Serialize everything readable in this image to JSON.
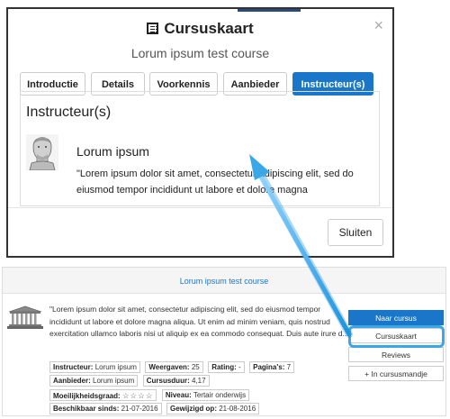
{
  "modal": {
    "title": "Cursuskaart",
    "subtitle": "Lorum ipsum test course",
    "close_glyph": "×",
    "tabs": [
      {
        "label": "Introductie",
        "active": false
      },
      {
        "label": "Details",
        "active": false
      },
      {
        "label": "Voorkennis",
        "active": false
      },
      {
        "label": "Aanbieder",
        "active": false
      },
      {
        "label": "Instructeur(s)",
        "active": true
      }
    ],
    "panel": {
      "heading": "Instructeur(s)",
      "instructor_name": "Lorum ipsum",
      "instructor_text": "\"Lorem ipsum dolor sit amet, consectetur adipiscing elit, sed do eiusmod tempor incididunt ut labore et dolore magna"
    },
    "close_button": "Sluiten"
  },
  "card": {
    "title": "Lorum ipsum test course",
    "description": "\"Lorem ipsum dolor sit amet, consectetur adipiscing elit, sed do eiusmod tempor incididunt ut labore et dolore magna aliqua. Ut enim ad minim veniam, quis nostrud exercitation ullamco laboris nisi ut aliquip ex ea commodo consequat. Duis aute irure d...",
    "meta": {
      "instructeur": {
        "label": "Instructeur:",
        "value": "Lorum ipsum"
      },
      "weergaven": {
        "label": "Weergaven:",
        "value": "25"
      },
      "rating": {
        "label": "Rating:",
        "value": "-"
      },
      "paginas": {
        "label": "Pagina's:",
        "value": "7"
      },
      "aanbieder": {
        "label": "Aanbieder:",
        "value": "Lorum ipsum"
      },
      "cursusduur": {
        "label": "Cursusduur:",
        "value": "4,17"
      },
      "moeilijkheid": {
        "label": "Moeilijkheidsgraad:",
        "stars": "☆☆☆☆"
      },
      "niveau": {
        "label": "Niveau:",
        "value": "Tertair onderwijs"
      },
      "beschikbaar": {
        "label": "Beschikbaar sinds:",
        "value": "21-07-2016"
      },
      "gewijzigd": {
        "label": "Gewijzigd op:",
        "value": "21-08-2016"
      }
    },
    "actions": {
      "naar_cursus": "Naar cursus",
      "cursuskaart": "Cursuskaart",
      "reviews": "Reviews",
      "mandje_plus": "+",
      "mandje": "In cursusmandje"
    }
  },
  "colors": {
    "accent": "#1a76c9",
    "highlight": "#3aa7e6"
  },
  "icons": [
    "list-icon",
    "close-icon",
    "instructor-avatar-icon",
    "temple-icon",
    "plus-icon",
    "star-icon"
  ]
}
